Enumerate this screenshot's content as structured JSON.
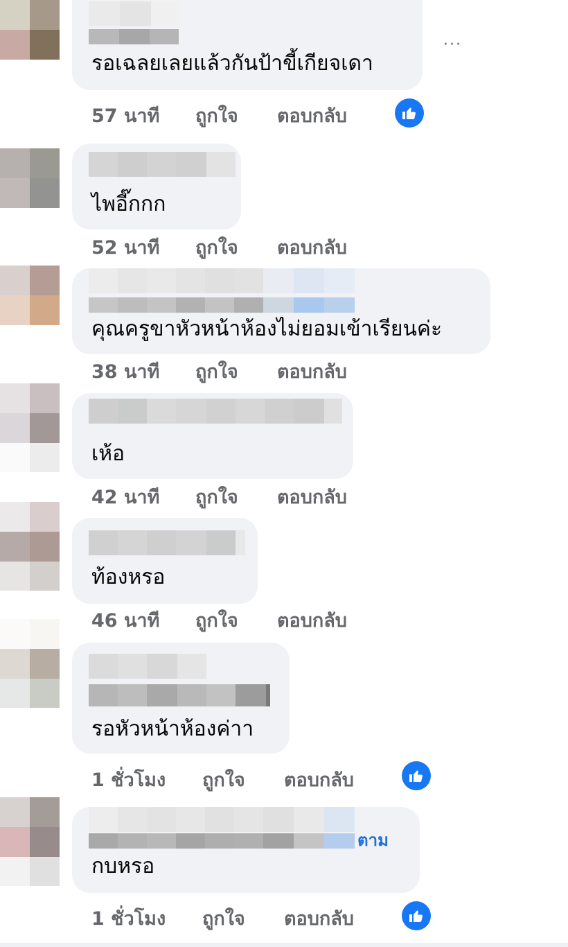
{
  "comments": [
    {
      "text": "รอเฉลยเลยแล้วกันป้าขี้เกียจเดา",
      "time": "57 นาที",
      "like": "ถูกใจ",
      "reply": "ตอบกลับ",
      "reacted": true
    },
    {
      "text": "ไพอี๊กกก",
      "time": "52 นาที",
      "like": "ถูกใจ",
      "reply": "ตอบกลับ",
      "reacted": false
    },
    {
      "text": "คุณครูขาหัวหน้าห้องไม่ยอมเข้าเรียนค่ะ",
      "time": "38 นาที",
      "like": "ถูกใจ",
      "reply": "ตอบกลับ",
      "reacted": false
    },
    {
      "text": "เห้อ",
      "time": "42 นาที",
      "like": "ถูกใจ",
      "reply": "ตอบกลับ",
      "reacted": false
    },
    {
      "text": "ท้องหรอ",
      "time": "46 นาที",
      "like": "ถูกใจ",
      "reply": "ตอบกลับ",
      "reacted": false
    },
    {
      "text": "รอหัวหน้าห้องค่าา",
      "time": "1 ชั่วโมง",
      "like": "ถูกใจ",
      "reply": "ตอบกลับ",
      "reacted": true
    },
    {
      "text": "กบหรอ",
      "time": "1 ชั่วโมง",
      "like": "ถูกใจ",
      "reply": "ตอบกลับ",
      "reacted": true,
      "follow": "ตาม"
    }
  ],
  "more_icon": "more-horizontal-icon",
  "reaction_icon": "thumbs-up-icon",
  "colors": {
    "bubble": "#f0f2f5",
    "meta": "#65676b",
    "like_blue": "#1877f2",
    "link_blue": "#216fdb"
  }
}
